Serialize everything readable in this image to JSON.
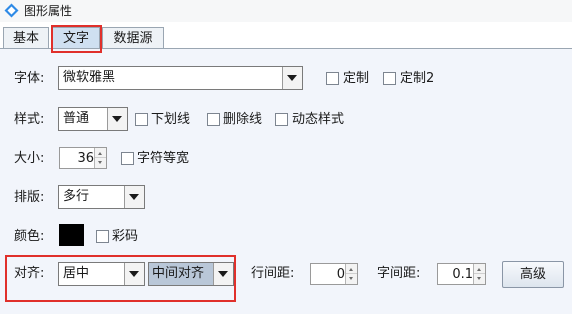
{
  "window": {
    "title": "图形属性"
  },
  "tabs": [
    "基本",
    "文字",
    "数据源"
  ],
  "font": {
    "label": "字体:",
    "value": "微软雅黑",
    "custom": "定制",
    "custom2": "定制2"
  },
  "style": {
    "label": "样式:",
    "value": "普通",
    "underline": "下划线",
    "strikethrough": "删除线",
    "dynamic_style": "动态样式"
  },
  "size": {
    "label": "大小:",
    "value": "36",
    "equal_width": "字符等宽"
  },
  "layout": {
    "label": "排版:",
    "value": "多行"
  },
  "color": {
    "label": "颜色:",
    "swatch": "#000000",
    "color_code": "彩码"
  },
  "align": {
    "label": "对齐:",
    "horizontal": "居中",
    "vertical": "中间对齐",
    "line_spacing_label": "行间距:",
    "line_spacing": "0",
    "char_spacing_label": "字间距:",
    "char_spacing": "0.1",
    "advanced": "高级"
  },
  "colors": {
    "highlight": "#e0302b",
    "active_tab": "#cfe0f1",
    "panel": "#f2f5fb"
  }
}
